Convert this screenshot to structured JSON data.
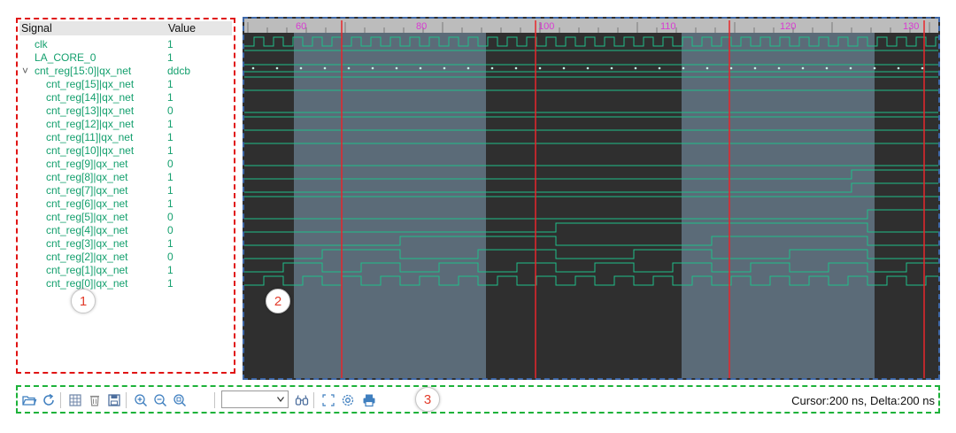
{
  "signal_panel": {
    "header": {
      "signal_label": "Signal",
      "value_label": "Value"
    },
    "rows": [
      {
        "name": "clk",
        "value": "1",
        "indent": 1
      },
      {
        "name": "LA_CORE_0",
        "value": "1",
        "indent": 1
      },
      {
        "name": "cnt_reg[15:0]|qx_net",
        "value": "ddcb",
        "indent": 1,
        "expanded": true
      },
      {
        "name": "cnt_reg[15]|qx_net",
        "value": "1",
        "indent": 2
      },
      {
        "name": "cnt_reg[14]|qx_net",
        "value": "1",
        "indent": 2
      },
      {
        "name": "cnt_reg[13]|qx_net",
        "value": "0",
        "indent": 2
      },
      {
        "name": "cnt_reg[12]|qx_net",
        "value": "1",
        "indent": 2
      },
      {
        "name": "cnt_reg[11]|qx_net",
        "value": "1",
        "indent": 2
      },
      {
        "name": "cnt_reg[10]|qx_net",
        "value": "1",
        "indent": 2
      },
      {
        "name": "cnt_reg[9]|qx_net",
        "value": "0",
        "indent": 2
      },
      {
        "name": "cnt_reg[8]|qx_net",
        "value": "1",
        "indent": 2
      },
      {
        "name": "cnt_reg[7]|qx_net",
        "value": "1",
        "indent": 2
      },
      {
        "name": "cnt_reg[6]|qx_net",
        "value": "1",
        "indent": 2
      },
      {
        "name": "cnt_reg[5]|qx_net",
        "value": "0",
        "indent": 2
      },
      {
        "name": "cnt_reg[4]|qx_net",
        "value": "0",
        "indent": 2
      },
      {
        "name": "cnt_reg[3]|qx_net",
        "value": "1",
        "indent": 2
      },
      {
        "name": "cnt_reg[2]|qx_net",
        "value": "0",
        "indent": 2
      },
      {
        "name": "cnt_reg[1]|qx_net",
        "value": "1",
        "indent": 2
      },
      {
        "name": "cnt_reg[0]|qx_net",
        "value": "1",
        "indent": 2
      }
    ]
  },
  "waveform": {
    "time_labels": [
      "60",
      "80",
      "100",
      "110",
      "120",
      "130"
    ],
    "colors": {
      "background": "#2f2f2f",
      "window": "#5b6b78",
      "signal": "#1fbf8a",
      "cursor": "#e8262b",
      "ruler": "#bcbcbc",
      "label": "#d93ad3"
    }
  },
  "toolbar": {
    "icons": [
      "open-folder",
      "refresh",
      "table",
      "delete",
      "save",
      "zoom-in",
      "zoom-out",
      "zoom-fit",
      "find",
      "fullscreen",
      "settings",
      "print"
    ],
    "zoom_value": "",
    "status": "Cursor:200 ns, Delta:200 ns"
  },
  "markers": [
    "1",
    "2",
    "3"
  ]
}
